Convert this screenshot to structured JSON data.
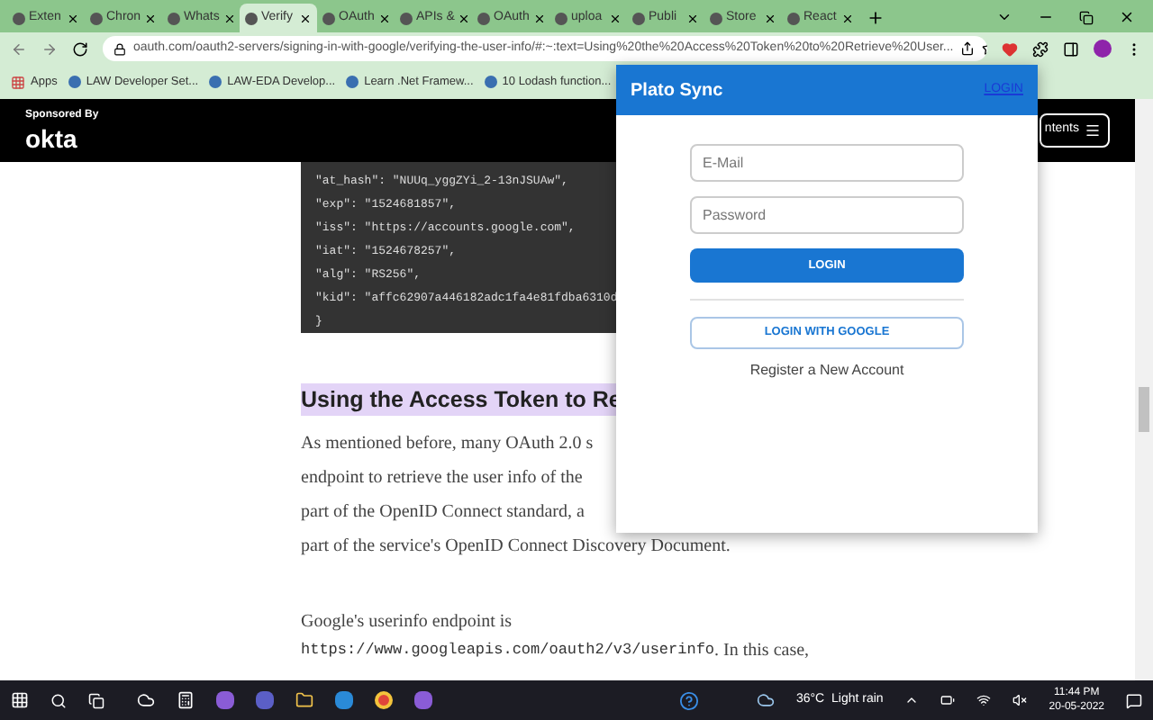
{
  "tabs": [
    {
      "label": "Exten",
      "selected": false
    },
    {
      "label": "Chron",
      "selected": false
    },
    {
      "label": "Whats",
      "selected": false
    },
    {
      "label": "Verify",
      "selected": true
    },
    {
      "label": "OAuth",
      "selected": false
    },
    {
      "label": "APIs &",
      "selected": false
    },
    {
      "label": "OAuth",
      "selected": false
    },
    {
      "label": "uploa",
      "selected": false
    },
    {
      "label": "Publi",
      "selected": false
    },
    {
      "label": "Store",
      "selected": false
    },
    {
      "label": "React",
      "selected": false
    }
  ],
  "address_bar": {
    "url": "oauth.com/oauth2-servers/signing-in-with-google/verifying-the-user-info/#:~:text=Using%20the%20Access%20Token%20to%20Retrieve%20User..."
  },
  "bookmarks": [
    "Apps",
    "LAW Developer Set...",
    "LAW-EDA Develop...",
    "Learn .Net Framew...",
    "10 Lodash function..."
  ],
  "site_header": {
    "sponsor_label": "Sponsored By",
    "sponsor_logo": "okta",
    "contents_button": "ntents"
  },
  "code_lines": [
    "\"at_hash\": \"NUUq_yggZYi_2-13nJSUAw\",",
    "\"exp\": \"1524681857\",",
    "\"iss\": \"https://accounts.google.com\",",
    "\"iat\": \"1524678257\",",
    "\"alg\": \"RS256\",",
    "\"kid\": \"affc62907a446182adc1fa4e81fdba6310d",
    "}"
  ],
  "heading": "Using the Access Token to Re",
  "paragraph_lines": [
    "As mentioned before, many OAuth 2.0 s",
    "endpoint to retrieve the user info of the",
    "part of the OpenID Connect standard, a",
    "part of the service's OpenID Connect Discovery Document."
  ],
  "paragraph2": {
    "text": "Google's userinfo endpoint is",
    "code": "https://www.googleapis.com/oauth2/v3/userinfo",
    "after": ". In this case,"
  },
  "popup": {
    "title": "Plato Sync",
    "header_link": "LOGIN",
    "email_placeholder": "E-Mail",
    "password_placeholder": "Password",
    "login_button": "LOGIN",
    "google_button": "LOGIN WITH GOOGLE",
    "register_link": "Register a New Account"
  },
  "taskbar": {
    "weather": "36°C  Light rain",
    "time": "11:44 PM",
    "date": "20-05-2022"
  }
}
